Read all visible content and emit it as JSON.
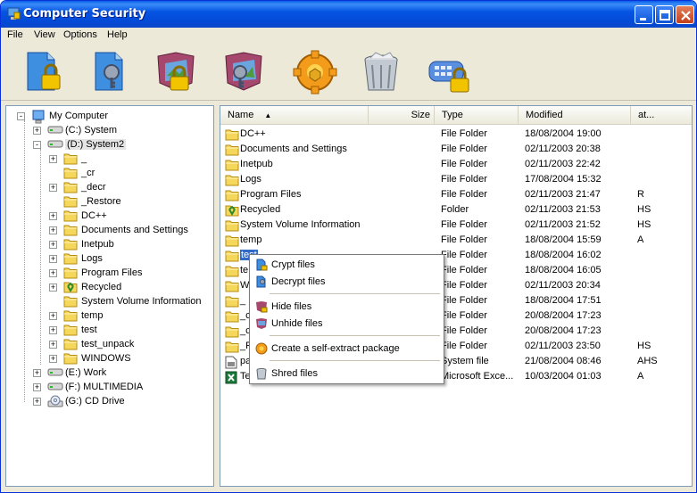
{
  "window": {
    "title": "Computer Security"
  },
  "menu": [
    "File",
    "View",
    "Options",
    "Help"
  ],
  "toolbar": [
    "crypt-files",
    "decrypt-files",
    "hide-files",
    "unhide-files",
    "self-extract-package",
    "shred-files",
    "password-lock"
  ],
  "tree": [
    {
      "label": "My Computer",
      "indent": 0,
      "expander": "-",
      "icon": "computer-icon"
    },
    {
      "label": "(C:)  System",
      "indent": 1,
      "expander": "+",
      "icon": "drive-icon"
    },
    {
      "label": "(D:)  System2",
      "indent": 1,
      "expander": "-",
      "icon": "drive-icon",
      "selected": true
    },
    {
      "label": "_",
      "indent": 2,
      "expander": "+",
      "icon": "folder-icon"
    },
    {
      "label": "_cr",
      "indent": 2,
      "expander": "",
      "icon": "folder-icon"
    },
    {
      "label": "_decr",
      "indent": 2,
      "expander": "+",
      "icon": "folder-icon"
    },
    {
      "label": "_Restore",
      "indent": 2,
      "expander": "",
      "icon": "folder-icon"
    },
    {
      "label": "DC++",
      "indent": 2,
      "expander": "+",
      "icon": "folder-icon"
    },
    {
      "label": "Documents and Settings",
      "indent": 2,
      "expander": "+",
      "icon": "folder-icon"
    },
    {
      "label": "Inetpub",
      "indent": 2,
      "expander": "+",
      "icon": "folder-icon"
    },
    {
      "label": "Logs",
      "indent": 2,
      "expander": "+",
      "icon": "folder-icon"
    },
    {
      "label": "Program Files",
      "indent": 2,
      "expander": "+",
      "icon": "folder-icon"
    },
    {
      "label": "Recycled",
      "indent": 2,
      "expander": "+",
      "icon": "recycle-icon"
    },
    {
      "label": "System Volume Information",
      "indent": 2,
      "expander": "",
      "icon": "folder-icon"
    },
    {
      "label": "temp",
      "indent": 2,
      "expander": "+",
      "icon": "folder-icon"
    },
    {
      "label": "test",
      "indent": 2,
      "expander": "+",
      "icon": "folder-icon"
    },
    {
      "label": "test_unpack",
      "indent": 2,
      "expander": "+",
      "icon": "folder-icon"
    },
    {
      "label": "WINDOWS",
      "indent": 2,
      "expander": "+",
      "icon": "folder-icon"
    },
    {
      "label": "(E:)  Work",
      "indent": 1,
      "expander": "+",
      "icon": "drive-icon"
    },
    {
      "label": "(F:)  MULTIMEDIA",
      "indent": 1,
      "expander": "+",
      "icon": "drive-icon"
    },
    {
      "label": "(G:)  CD Drive",
      "indent": 1,
      "expander": "+",
      "icon": "cd-icon"
    }
  ],
  "columns": {
    "name": "Name",
    "size": "Size",
    "type": "Type",
    "modified": "Modified",
    "attr": "at..."
  },
  "files": [
    {
      "name": "DC++",
      "type": "File Folder",
      "modified": "18/08/2004 19:00",
      "attr": "",
      "icon": "folder"
    },
    {
      "name": "Documents and Settings",
      "type": "File Folder",
      "modified": "02/11/2003 20:38",
      "attr": "",
      "icon": "folder"
    },
    {
      "name": "Inetpub",
      "type": "File Folder",
      "modified": "02/11/2003 22:42",
      "attr": "",
      "icon": "folder"
    },
    {
      "name": "Logs",
      "type": "File Folder",
      "modified": "17/08/2004 15:32",
      "attr": "",
      "icon": "folder"
    },
    {
      "name": "Program Files",
      "type": "File Folder",
      "modified": "02/11/2003 21:47",
      "attr": "R",
      "icon": "folder"
    },
    {
      "name": "Recycled",
      "type": "Folder",
      "modified": "02/11/2003 21:53",
      "attr": "HS",
      "icon": "recycle"
    },
    {
      "name": "System Volume Information",
      "type": "File Folder",
      "modified": "02/11/2003 21:52",
      "attr": "HS",
      "icon": "folder"
    },
    {
      "name": "temp",
      "type": "File Folder",
      "modified": "18/08/2004 15:59",
      "attr": "A",
      "icon": "folder"
    },
    {
      "name": "test",
      "type": "File Folder",
      "modified": "18/08/2004 16:02",
      "attr": "",
      "icon": "folder",
      "selected": true
    },
    {
      "name": "te",
      "type": "File Folder",
      "modified": "18/08/2004 16:05",
      "attr": "",
      "icon": "folder"
    },
    {
      "name": "W",
      "type": "File Folder",
      "modified": "02/11/2003 20:34",
      "attr": "",
      "icon": "folder"
    },
    {
      "name": "_",
      "type": "File Folder",
      "modified": "18/08/2004 17:51",
      "attr": "",
      "icon": "folder"
    },
    {
      "name": "_c",
      "type": "File Folder",
      "modified": "20/08/2004 17:23",
      "attr": "",
      "icon": "folder"
    },
    {
      "name": "_c",
      "type": "File Folder",
      "modified": "20/08/2004 17:23",
      "attr": "",
      "icon": "folder"
    },
    {
      "name": "_R",
      "type": "File Folder",
      "modified": "02/11/2003 23:50",
      "attr": "HS",
      "icon": "folder"
    },
    {
      "name": "pa",
      "type": "System file",
      "modified": "21/08/2004 08:46",
      "attr": "AHS",
      "icon": "sysfile"
    },
    {
      "name": "Te",
      "type": "Microsoft Exce...",
      "modified": "10/03/2004 01:03",
      "attr": "A",
      "icon": "excel"
    }
  ],
  "context_menu": {
    "items": [
      {
        "label": "Crypt files",
        "icon": "crypt-icon"
      },
      {
        "label": "Decrypt files",
        "icon": "decrypt-icon"
      },
      {
        "label": "Hide files",
        "icon": "hide-icon"
      },
      {
        "label": "Unhide files",
        "icon": "unhide-icon"
      },
      {
        "label": "Create a self-extract package",
        "icon": "package-icon"
      },
      {
        "label": "Shred files",
        "icon": "shred-icon"
      }
    ]
  },
  "colors": {
    "selection": "#316ac5",
    "folder": "#f5d75c",
    "titlebar": "#0a5de6"
  }
}
